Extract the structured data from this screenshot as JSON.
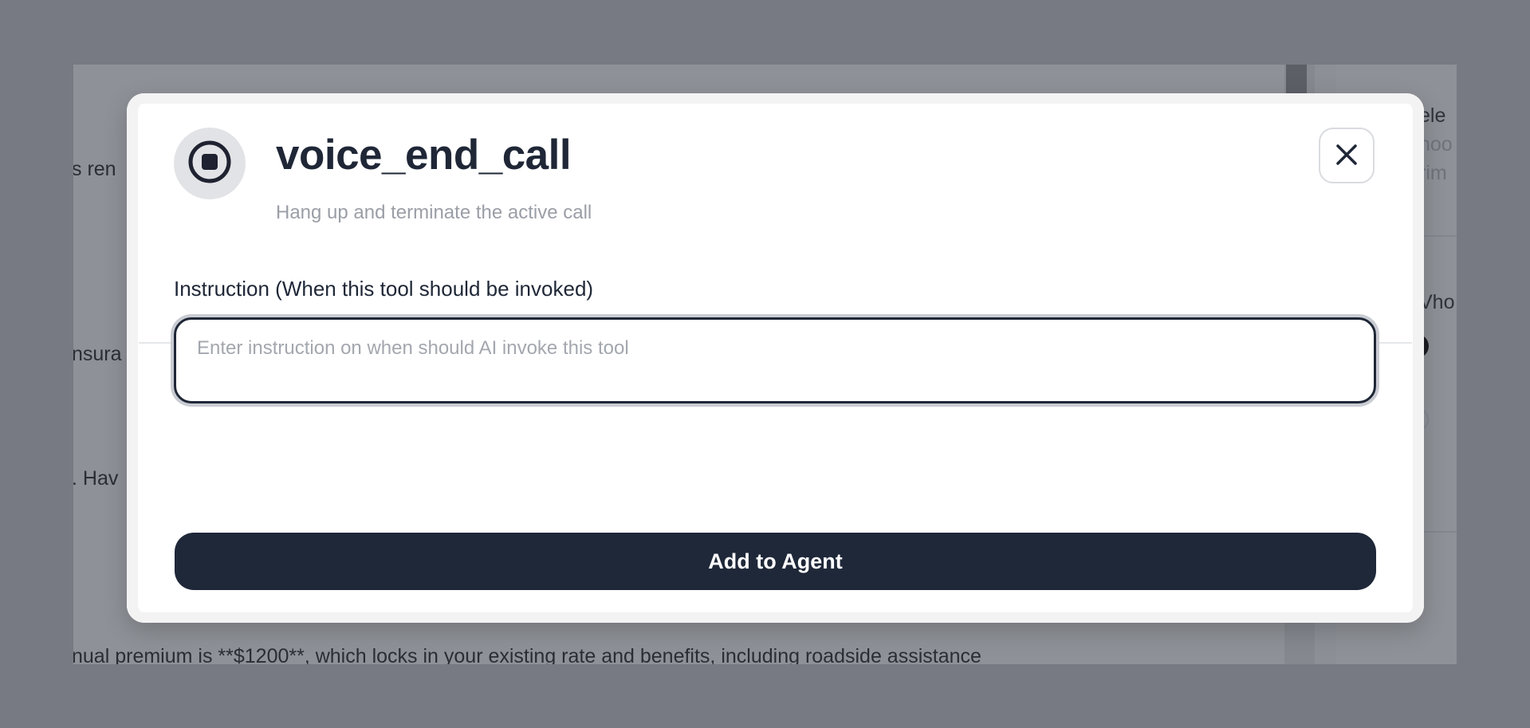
{
  "modal": {
    "tool_name": "voice_end_call",
    "tool_description": "Hang up and terminate the active call",
    "instruction_label": "Instruction (When this tool should be invoked)",
    "instruction_value": "",
    "instruction_placeholder": "Enter instruction on when should AI invoke this tool",
    "submit_label": "Add to Agent",
    "tool_icon": "stop-circle-icon",
    "close_icon": "close-icon"
  },
  "background": {
    "main_snippets": [
      "s ren",
      "nsura",
      ". Hav",
      "nual premium is **$1200**, which locks in your existing rate and benefits, including roadside assistance"
    ],
    "side_snippets": [
      "ele",
      "hoo",
      "rim",
      "Vho"
    ]
  },
  "colors": {
    "overlay": "#777a83",
    "primary": "#1f2839",
    "title_text": "#1f2737",
    "muted_text": "#9a9ea6"
  }
}
